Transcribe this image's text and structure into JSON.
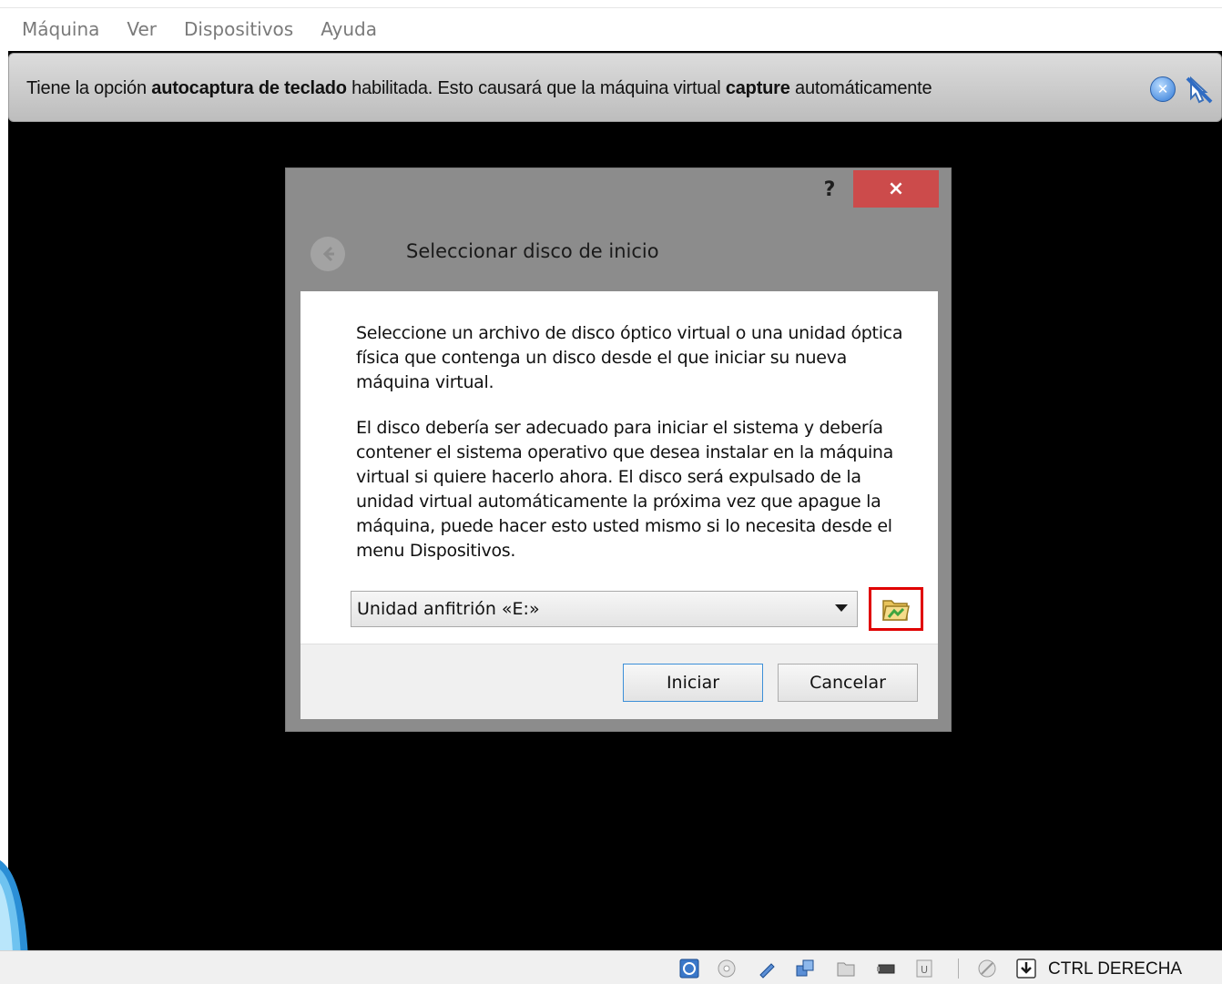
{
  "menubar": {
    "items": [
      "Máquina",
      "Ver",
      "Dispositivos",
      "Ayuda"
    ]
  },
  "notice": {
    "part1": "Tiene la opción ",
    "bold1": "autocaptura de teclado",
    "part2": " habilitada. Esto causará que la máquina virtual ",
    "bold2": "capture",
    "part3": " automáticamente"
  },
  "dialog": {
    "help": "?",
    "close": "×",
    "title": "Seleccionar disco de inicio",
    "para1": "Seleccione un archivo de disco óptico virtual o una unidad óptica física que contenga un disco desde el que iniciar su nueva máquina virtual.",
    "para2": "El disco debería ser adecuado para iniciar el sistema y debería contener el sistema operativo que desea instalar en la máquina virtual si quiere hacerlo ahora. El disco será expulsado de la unidad virtual automáticamente la próxima vez que apague la máquina, puede hacer esto usted mismo si lo necesita desde el menu Dispositivos.",
    "combo_value": "Unidad anfitrión «E:»",
    "start_label": "Iniciar",
    "cancel_label": "Cancelar"
  },
  "statusbar": {
    "host_key": "CTRL DERECHA",
    "icons": [
      "hard-disk-icon",
      "optical-disk-icon",
      "usb-icon",
      "network-icon",
      "shared-folder-icon",
      "display-icon",
      "video-capture-icon",
      "mouse-integration-icon",
      "keyboard-capture-icon"
    ]
  },
  "colors": {
    "close_red": "#cc4b4b",
    "highlight_red": "#e00000",
    "default_button_border": "#3c8fd8"
  }
}
